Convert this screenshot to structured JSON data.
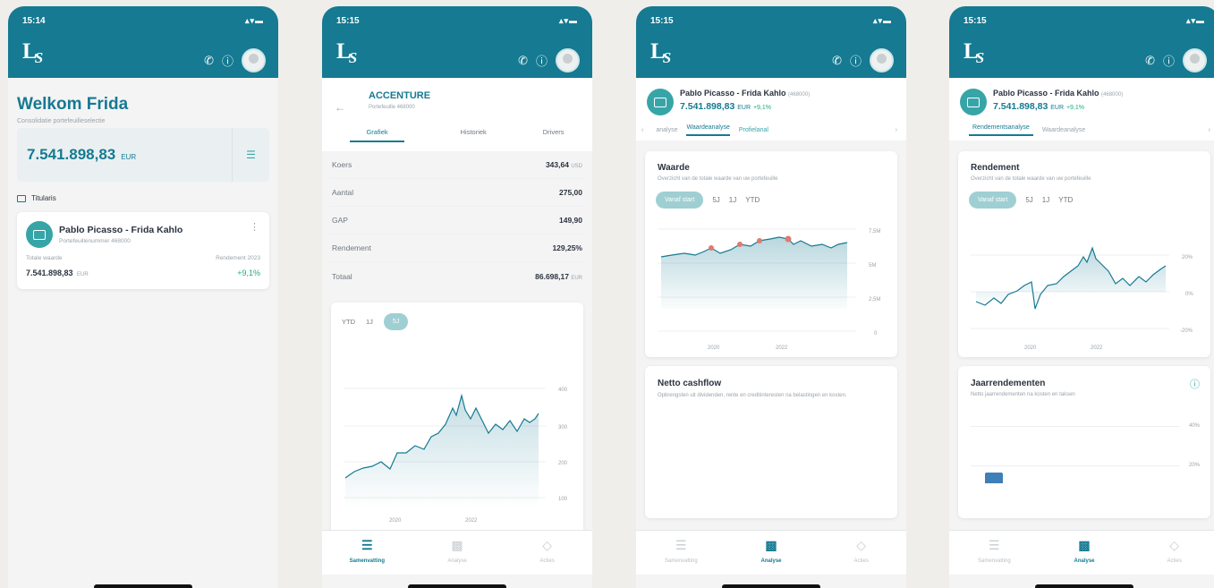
{
  "status": {
    "time1": "15:14",
    "time2": "15:15",
    "time3": "15:15",
    "time4": "15:15",
    "icons": "▴▾▬"
  },
  "logo": "LS",
  "header_icons": [
    "phone-icon",
    "help-icon",
    "avatar"
  ],
  "screen1": {
    "title": "Welkom Frida",
    "subtitle": "Consolidatie portefeuilleselectie",
    "total_amount": "7.541.898,83",
    "total_currency": "EUR",
    "section_label": "Titularis",
    "portfolio": {
      "name": "Pablo Picasso - Frida Kahlo",
      "number": "Portefeuillenummer 468000",
      "value_label": "Totale waarde",
      "value": "7.541.898,83",
      "value_currency": "EUR",
      "return_label": "Rendement 2023",
      "return_value": "+9,1%"
    }
  },
  "screen2": {
    "title": "ACCENTURE",
    "subtitle": "Portefeuille 468000",
    "tabs": [
      "Grafiek",
      "Historiek",
      "Drivers"
    ],
    "rows": [
      {
        "label": "Koers",
        "value": "343,64",
        "unit": "USD"
      },
      {
        "label": "Aantal",
        "value": "275,00",
        "unit": ""
      },
      {
        "label": "GAP",
        "value": "149,90",
        "unit": ""
      },
      {
        "label": "Rendement",
        "value": "129,25%",
        "unit": ""
      },
      {
        "label": "Totaal",
        "value": "86.698,17",
        "unit": "EUR"
      }
    ],
    "periods": [
      "YTD",
      "1J",
      "5J"
    ],
    "y_ticks": [
      "400",
      "300",
      "200",
      "100"
    ],
    "x_ticks": [
      "2020",
      "2022"
    ]
  },
  "screen3": {
    "portfolio_name": "Pablo Picasso - Frida Kahlo",
    "portfolio_id": "(468000)",
    "amount": "7.541.898,83",
    "currency": "EUR",
    "change": "+9,1%",
    "tabs": [
      "analyse",
      "Waardeanalyse",
      "Profielanal"
    ],
    "card1_title": "Waarde",
    "card1_sub": "Overzicht van de totale waarde van uw portefeuille",
    "periods": [
      "Vanaf start",
      "5J",
      "1J",
      "YTD"
    ],
    "y_ticks": [
      "7,5M",
      "5M",
      "2,5M",
      "0"
    ],
    "x_ticks": [
      "2020",
      "2022"
    ],
    "card2_title": "Netto cashflow",
    "card2_sub": "Opbrengsten uit dividenden, rente en creditinteresten na belastingen en kosten."
  },
  "screen4": {
    "portfolio_name": "Pablo Picasso - Frida Kahlo",
    "portfolio_id": "(468000)",
    "amount": "7.541.898,83",
    "currency": "EUR",
    "change": "+9,1%",
    "tabs": [
      "Rendementsanalyse",
      "Waardeanalyse"
    ],
    "card1_title": "Rendement",
    "card1_sub": "Overzicht van de totale waarde van uw portefeuille",
    "periods": [
      "Vanaf start",
      "5J",
      "1J",
      "YTD"
    ],
    "y_ticks": [
      "20%",
      "0%",
      "-20%"
    ],
    "x_ticks": [
      "2020",
      "2022"
    ],
    "card2_title": "Jaarrendementen",
    "card2_sub": "Netto jaarrendementen na kosten en taksen",
    "card2_ticks": [
      "40%",
      "20%"
    ]
  },
  "nav": [
    "Samenvatting",
    "Analyse",
    "Acties"
  ],
  "colors": {
    "brand": "#157a92",
    "accent": "#37a5a8",
    "positive": "#1fae79",
    "marker": "#e07a6f"
  }
}
